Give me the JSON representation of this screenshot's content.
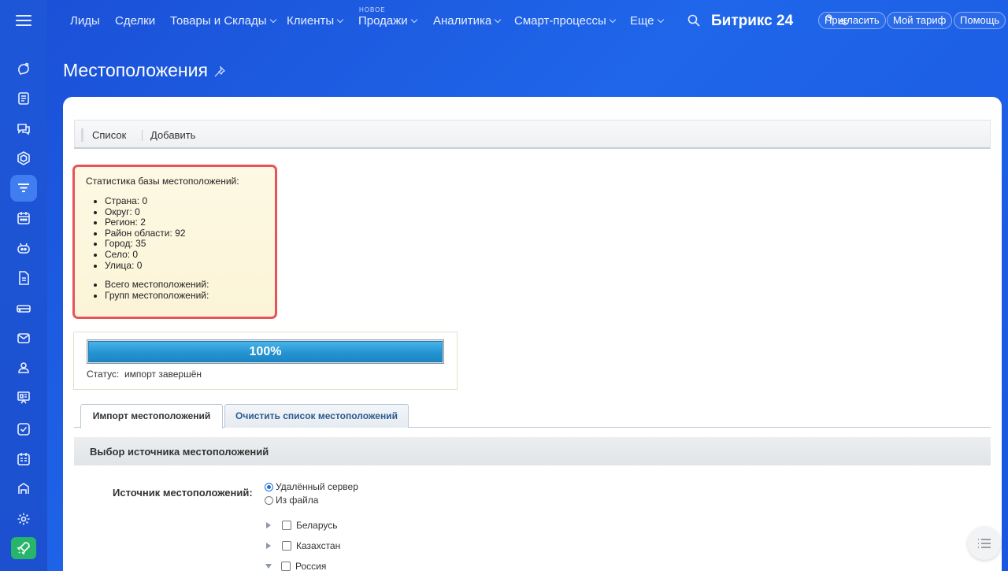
{
  "nav": {
    "items": [
      {
        "label": "Лиды",
        "chevron": false
      },
      {
        "label": "Сделки",
        "chevron": false
      },
      {
        "label": "Товары и Склады",
        "chevron": true
      },
      {
        "label": "Клиенты",
        "chevron": true
      },
      {
        "label": "Продажи",
        "chevron": true
      },
      {
        "label": "Аналитика",
        "chevron": true
      },
      {
        "label": "Смарт-процессы",
        "chevron": true
      },
      {
        "label": "Еще",
        "chevron": true
      }
    ],
    "new_tag": "НОВОЕ",
    "brand": "Битрикс 24",
    "buttons": {
      "invite": "Пригласить",
      "tariff": "Мой тариф",
      "help": "Помощь"
    }
  },
  "page": {
    "title": "Местоположения"
  },
  "toolbar": {
    "list": "Список",
    "add": "Добавить"
  },
  "stats": {
    "title": "Статистика базы местоположений:",
    "items": [
      "Страна: 0",
      "Округ: 0",
      "Регион: 2",
      "Район области: 92",
      "Город: 35",
      "Село: 0",
      "Улица: 0"
    ],
    "totals": [
      "Всего местоположений:",
      "Групп местоположений:"
    ]
  },
  "progress": {
    "percent": 100,
    "label": "100%",
    "status_label": "Статус:",
    "status_value": "импорт завершён"
  },
  "tabs": {
    "import": "Импорт местоположений",
    "clear": "Очистить список местоположений"
  },
  "section": {
    "title": "Выбор источника местоположений"
  },
  "source": {
    "label": "Источник местоположений:",
    "options": [
      {
        "label": "Удалённый сервер",
        "selected": true
      },
      {
        "label": "Из файла",
        "selected": false
      }
    ]
  },
  "tree": [
    {
      "label": "Беларусь",
      "expanded": false
    },
    {
      "label": "Казахстан",
      "expanded": false
    },
    {
      "label": "Россия",
      "expanded": true
    }
  ],
  "colors": {
    "accent": "#1f66ea",
    "highlight": "#e6545a",
    "progress": "#2494d2"
  }
}
